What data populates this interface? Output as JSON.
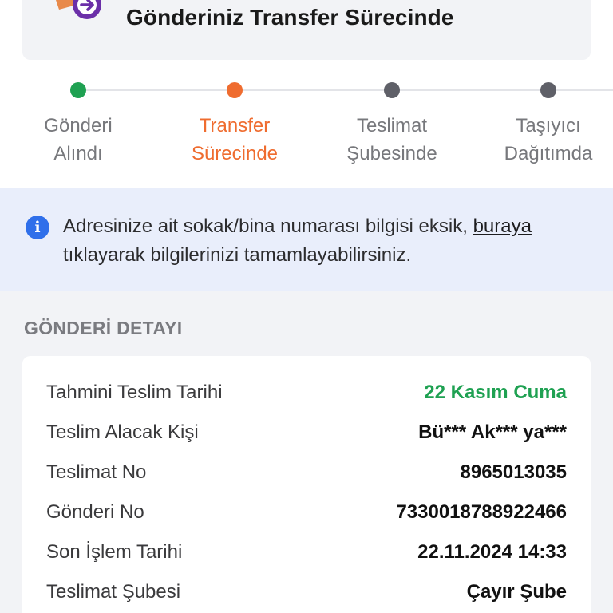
{
  "header": {
    "title": "Gönderiniz Transfer Sürecinde",
    "logo": "package-transfer-icon"
  },
  "steps": [
    {
      "line1": "Gönderi",
      "line2": "Alındı",
      "status": "done",
      "color": "#1fa152"
    },
    {
      "line1": "Transfer",
      "line2": "Sürecinde",
      "status": "active",
      "color": "#ef6c2f"
    },
    {
      "line1": "Teslimat",
      "line2": "Şubesinde",
      "status": "pending",
      "color": "#5f6068"
    },
    {
      "line1": "Taşıyıcı",
      "line2": "Dağıtımda",
      "status": "pending",
      "color": "#5f6068"
    }
  ],
  "notice": {
    "icon": "info-icon",
    "text_before": "Adresinize ait sokak/bina numarası bilgisi eksik, ",
    "link": "buraya",
    "text_after": " tıklayarak bilgilerinizi tamamlayabilirsiniz."
  },
  "details": {
    "section_title": "GÖNDERİ DETAYI",
    "rows": [
      {
        "label": "Tahmini Teslim Tarihi",
        "value": "22 Kasım Cuma"
      },
      {
        "label": "Teslim Alacak Kişi",
        "value": "Bü*** Ak*** ya***"
      },
      {
        "label": "Teslimat No",
        "value": "8965013035"
      },
      {
        "label": "Gönderi No",
        "value": "7330018788922466"
      },
      {
        "label": "Son İşlem Tarihi",
        "value": "22.11.2024 14:33"
      },
      {
        "label": "Teslimat Şubesi",
        "value": "Çayır Şube"
      }
    ]
  },
  "colors": {
    "accent_orange": "#ef6c2f",
    "success_green": "#1fa152",
    "info_blue": "#2f6fea",
    "logo_purple": "#6b2fa8"
  }
}
